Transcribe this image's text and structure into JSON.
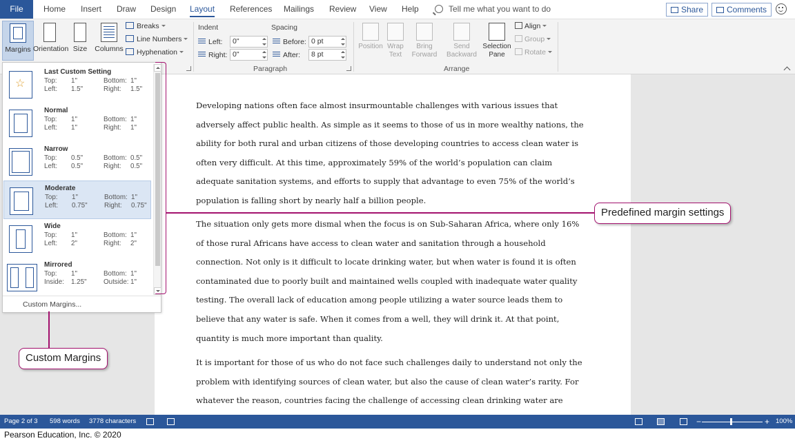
{
  "tabs": {
    "file": "File",
    "items": [
      "Home",
      "Insert",
      "Draw",
      "Design",
      "Layout",
      "References",
      "Mailings",
      "Review",
      "View",
      "Help"
    ],
    "active": "Layout",
    "tell_me": "Tell me what you want to do",
    "share": "Share",
    "comments": "Comments"
  },
  "ribbon": {
    "page_setup": {
      "margins": "Margins",
      "orientation": "Orientation",
      "size": "Size",
      "columns": "Columns",
      "breaks": "Breaks",
      "line_numbers": "Line Numbers",
      "hyphenation": "Hyphenation"
    },
    "paragraph": {
      "group_label": "Paragraph",
      "indent_head": "Indent",
      "spacing_head": "Spacing",
      "left_label": "Left:",
      "left_value": "0\"",
      "right_label": "Right:",
      "right_value": "0\"",
      "before_label": "Before:",
      "before_value": "0 pt",
      "after_label": "After:",
      "after_value": "8 pt"
    },
    "arrange": {
      "group_label": "Arrange",
      "position": "Position",
      "wrap_text": [
        "Wrap",
        "Text"
      ],
      "bring_forward": [
        "Bring",
        "Forward"
      ],
      "send_backward": [
        "Send",
        "Backward"
      ],
      "selection_pane": [
        "Selection",
        "Pane"
      ],
      "align": "Align",
      "group": "Group",
      "rotate": "Rotate"
    }
  },
  "margins_menu": {
    "items": [
      {
        "name": "Last Custom Setting",
        "top": "1\"",
        "bottom": "1\"",
        "left": "1.5\"",
        "right": "1.5\"",
        "l1": "Left:",
        "r1": "Right:"
      },
      {
        "name": "Normal",
        "top": "1\"",
        "bottom": "1\"",
        "left": "1\"",
        "right": "1\"",
        "l1": "Left:",
        "r1": "Right:"
      },
      {
        "name": "Narrow",
        "top": "0.5\"",
        "bottom": "0.5\"",
        "left": "0.5\"",
        "right": "0.5\"",
        "l1": "Left:",
        "r1": "Right:"
      },
      {
        "name": "Moderate",
        "top": "1\"",
        "bottom": "1\"",
        "left": "0.75\"",
        "right": "0.75\"",
        "l1": "Left:",
        "r1": "Right:"
      },
      {
        "name": "Wide",
        "top": "1\"",
        "bottom": "1\"",
        "left": "2\"",
        "right": "2\"",
        "l1": "Left:",
        "r1": "Right:"
      },
      {
        "name": "Mirrored",
        "top": "1\"",
        "bottom": "1\"",
        "left": "1.25\"",
        "right": "1\"",
        "l1": "Inside:",
        "r1": "Outside:"
      }
    ],
    "top_label": "Top:",
    "bottom_label": "Bottom:",
    "custom_margins": "Custom Margins..."
  },
  "document": {
    "paragraphs": [
      [
        "Developing nations often face almost insurmountable challenges with various issues that",
        "adversely affect public health. As simple as it seems to those of us in more wealthy nations, the",
        "ability for both rural and urban citizens of those developing countries to access clean water is",
        "often very difficult. At this time, approximately 59% of the world’s population can claim",
        "adequate sanitation systems, and efforts to supply that advantage to even 75% of the world’s",
        "population is falling short by nearly half a billion people."
      ],
      [
        "The situation only gets more dismal when the focus is on Sub-Saharan Africa, where only 16%",
        "of those rural Africans have access to clean water and sanitation through a household",
        "connection. Not only is it difficult to locate drinking water, but when water is found it is often",
        "contaminated due to poorly built and maintained wells coupled with inadequate water quality",
        "testing. The overall lack of education among people utilizing a water source leads them to",
        "believe that any water is safe. When it comes from a well, they will drink it. At that point,",
        "quantity is much more important than quality."
      ],
      [
        "It is important for those of us who do not face such challenges daily to understand not only the",
        "problem with identifying sources of clean water, but also the cause of clean water’s rarity. For",
        "whatever the reason, countries facing the challenge of accessing clean drinking water are"
      ]
    ]
  },
  "callouts": {
    "predefined": "Predefined margin settings",
    "custom": "Custom Margins"
  },
  "status": {
    "page": "Page 2 of 3",
    "words": "598 words",
    "characters": "3778 characters",
    "zoom": "100%"
  },
  "credit": "Pearson Education, Inc. © 2020",
  "colors": {
    "accent": "#2b579a",
    "callout": "#a2106d"
  }
}
